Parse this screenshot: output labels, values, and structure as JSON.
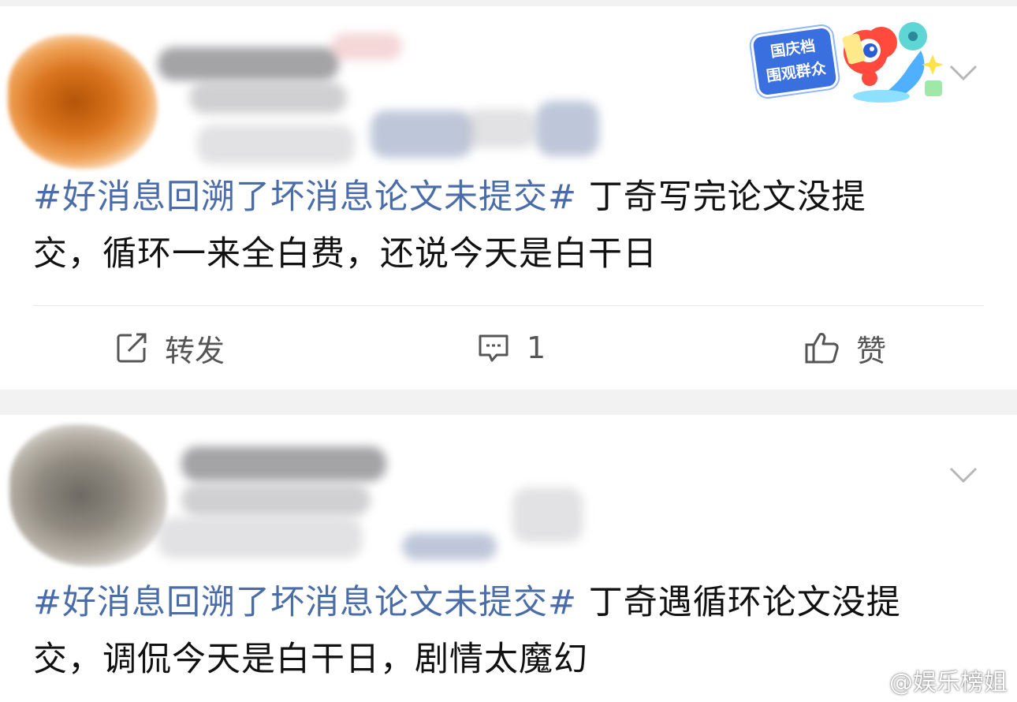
{
  "posts": [
    {
      "badge": {
        "line1": "国庆档",
        "line2": "围观群众"
      },
      "hashtag": "#好消息回溯了坏消息论文未提交#",
      "text_line1_rest": " 丁奇写完论文没提",
      "text_line2": "交，循环一来全白费，还说今天是白干日",
      "actions": {
        "repost_label": "转发",
        "comment_count": "1",
        "like_label": "赞"
      }
    },
    {
      "hashtag": "#好消息回溯了坏消息论文未提交#",
      "text_line1_rest": " 丁奇遇循环论文没提",
      "text_line2": "交，调侃今天是白干日，剧情太魔幻"
    }
  ],
  "watermark": {
    "text": "@娱乐榜姐"
  },
  "colors": {
    "hashtag": "#4a6ca8",
    "text": "#111111",
    "action_text": "#555555",
    "background": "#f2f2f2",
    "card": "#ffffff"
  },
  "icons": {
    "repost": "edit-square-icon",
    "comment": "comment-bubble-icon",
    "like": "thumbs-up-icon",
    "more": "chevron-down-icon",
    "watermark": "weibo-logo-icon"
  }
}
